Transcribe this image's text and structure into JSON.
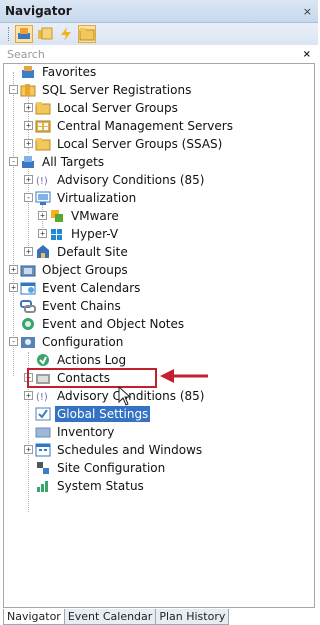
{
  "window": {
    "title": "Navigator",
    "close": "×"
  },
  "toolbar": {
    "buttons": [
      "targets-icon",
      "folders-icon",
      "lightning-icon",
      "folder-view-icon"
    ]
  },
  "search": {
    "placeholder": "Search",
    "clear": "×"
  },
  "tree": [
    {
      "id": "favorites",
      "label": "Favorites",
      "icon": "favorites-icon"
    },
    {
      "id": "sql-server-registrations",
      "label": "SQL Server Registrations",
      "icon": "registrations-icon",
      "expander": "-"
    },
    {
      "id": "local-server-groups",
      "label": "Local Server Groups",
      "icon": "folder-icon",
      "expander": "+"
    },
    {
      "id": "central-management-servers",
      "label": "Central Management Servers",
      "icon": "cms-icon",
      "expander": "+"
    },
    {
      "id": "local-server-groups-ssas",
      "label": "Local Server Groups (SSAS)",
      "icon": "folder-icon",
      "expander": "+"
    },
    {
      "id": "all-targets",
      "label": "All Targets",
      "icon": "targets-icon",
      "expander": "-"
    },
    {
      "id": "advisory-conditions",
      "label": "Advisory Conditions (85)",
      "icon": "advisory-icon",
      "expander": "+"
    },
    {
      "id": "virtualization",
      "label": "Virtualization",
      "icon": "virtualization-icon",
      "expander": "-"
    },
    {
      "id": "vmware",
      "label": "VMware",
      "icon": "vmware-icon",
      "expander": "+"
    },
    {
      "id": "hyper-v",
      "label": "Hyper-V",
      "icon": "hyperv-icon",
      "expander": "+"
    },
    {
      "id": "default-site",
      "label": "Default Site",
      "icon": "site-icon",
      "expander": "+"
    },
    {
      "id": "object-groups",
      "label": "Object Groups",
      "icon": "object-groups-icon",
      "expander": "+"
    },
    {
      "id": "event-calendars",
      "label": "Event Calendars",
      "icon": "calendar-icon",
      "expander": "+"
    },
    {
      "id": "event-chains",
      "label": "Event Chains",
      "icon": "chains-icon"
    },
    {
      "id": "event-and-object-notes",
      "label": "Event and Object Notes",
      "icon": "notes-icon"
    },
    {
      "id": "configuration",
      "label": "Configuration",
      "icon": "configuration-icon",
      "expander": "-"
    },
    {
      "id": "actions-log",
      "label": "Actions Log",
      "icon": "actions-log-icon"
    },
    {
      "id": "contacts",
      "label": "Contacts",
      "icon": "contacts-icon",
      "expander": "+"
    },
    {
      "id": "advisory-conditions-config",
      "label": "Advisory Conditions (85)",
      "icon": "advisory-icon",
      "expander": "+"
    },
    {
      "id": "global-settings",
      "label": "Global Settings",
      "icon": "settings-icon",
      "selected": true
    },
    {
      "id": "inventory",
      "label": "Inventory",
      "icon": "inventory-icon"
    },
    {
      "id": "schedules-and-windows",
      "label": "Schedules and Windows",
      "icon": "schedules-icon",
      "expander": "+"
    },
    {
      "id": "site-configuration",
      "label": "Site Configuration",
      "icon": "site-config-icon"
    },
    {
      "id": "system-status",
      "label": "System Status",
      "icon": "status-icon"
    }
  ],
  "tabs": [
    {
      "label": "Navigator",
      "active": true
    },
    {
      "label": "Event Calendar",
      "active": false
    },
    {
      "label": "Plan History",
      "active": false
    }
  ],
  "colors": {
    "selection": "#3372c4",
    "callout": "#c2202f",
    "titlebar": "#c7d8ee"
  }
}
